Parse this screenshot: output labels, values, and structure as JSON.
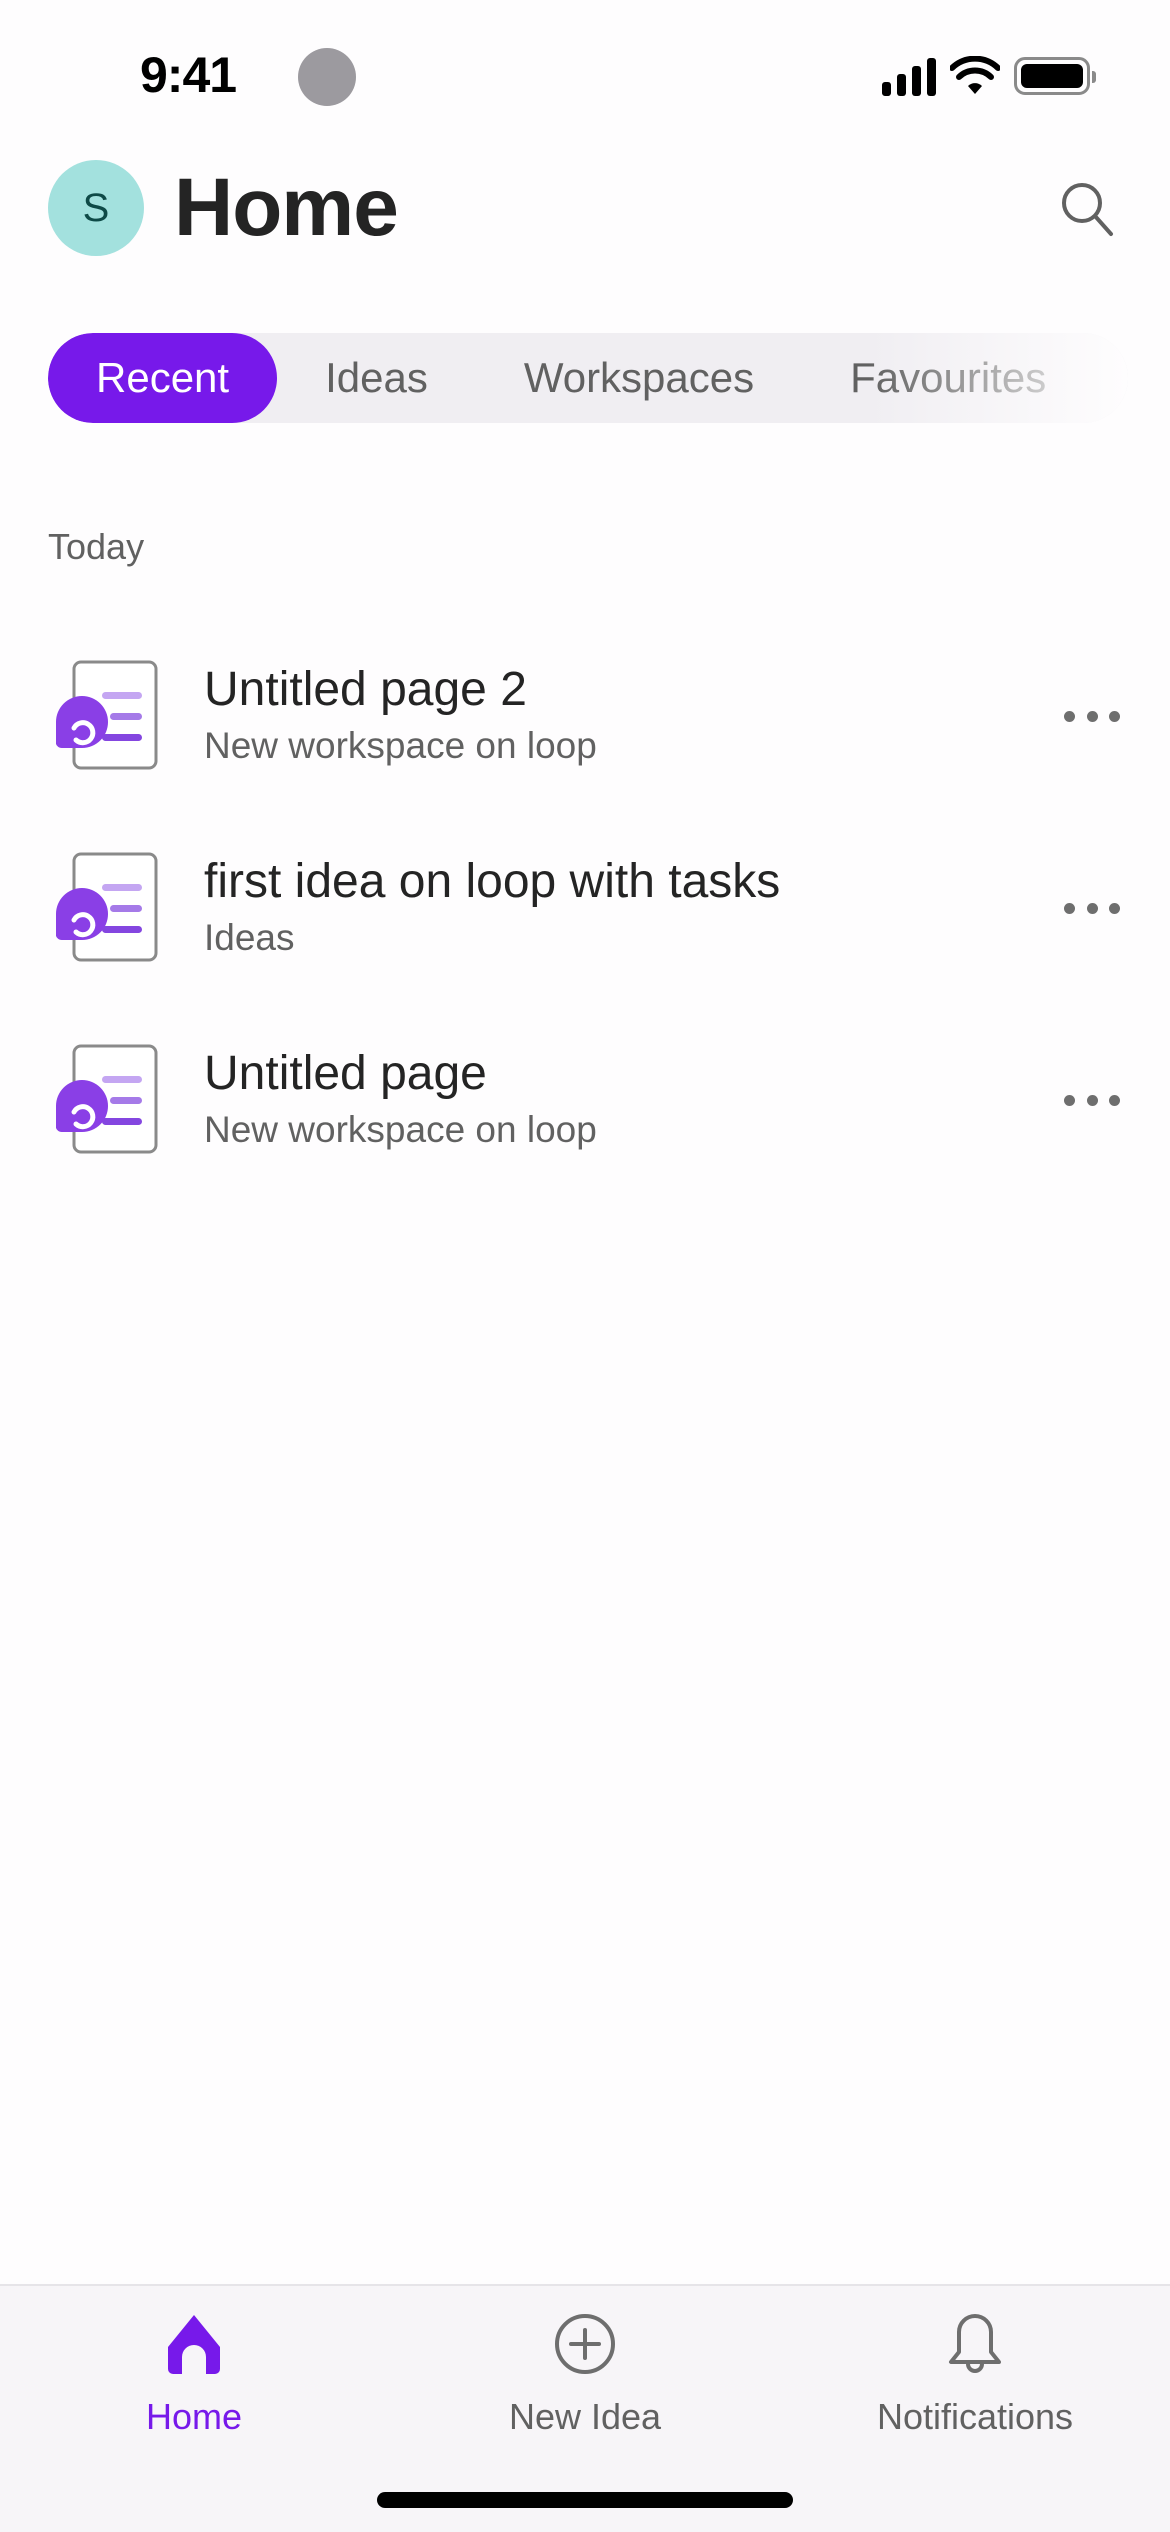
{
  "status_bar": {
    "time": "9:41",
    "icons": [
      "cellular-signal-icon",
      "wifi-icon",
      "battery-icon"
    ]
  },
  "header": {
    "avatar_initial": "S",
    "title": "Home",
    "search_icon": "search-icon"
  },
  "tabs": [
    {
      "label": "Recent",
      "active": true
    },
    {
      "label": "Ideas",
      "active": false
    },
    {
      "label": "Workspaces",
      "active": false
    },
    {
      "label": "Favourites",
      "active": false
    }
  ],
  "section": {
    "label": "Today"
  },
  "items": [
    {
      "title": "Untitled page 2",
      "subtitle": "New workspace on loop",
      "icon": "loop-page-icon"
    },
    {
      "title": "first idea on loop with tasks",
      "subtitle": "Ideas",
      "icon": "loop-page-icon"
    },
    {
      "title": "Untitled page",
      "subtitle": "New workspace on loop",
      "icon": "loop-page-icon"
    }
  ],
  "bottom_nav": [
    {
      "label": "Home",
      "icon": "home-icon",
      "active": true
    },
    {
      "label": "New Idea",
      "icon": "add-circle-icon",
      "active": false
    },
    {
      "label": "Notifications",
      "icon": "bell-icon",
      "active": false
    }
  ],
  "colors": {
    "accent": "#7719ea",
    "avatar_bg": "#a3e1de",
    "tab_track": "#f0eef2",
    "secondary_text": "#616161"
  }
}
